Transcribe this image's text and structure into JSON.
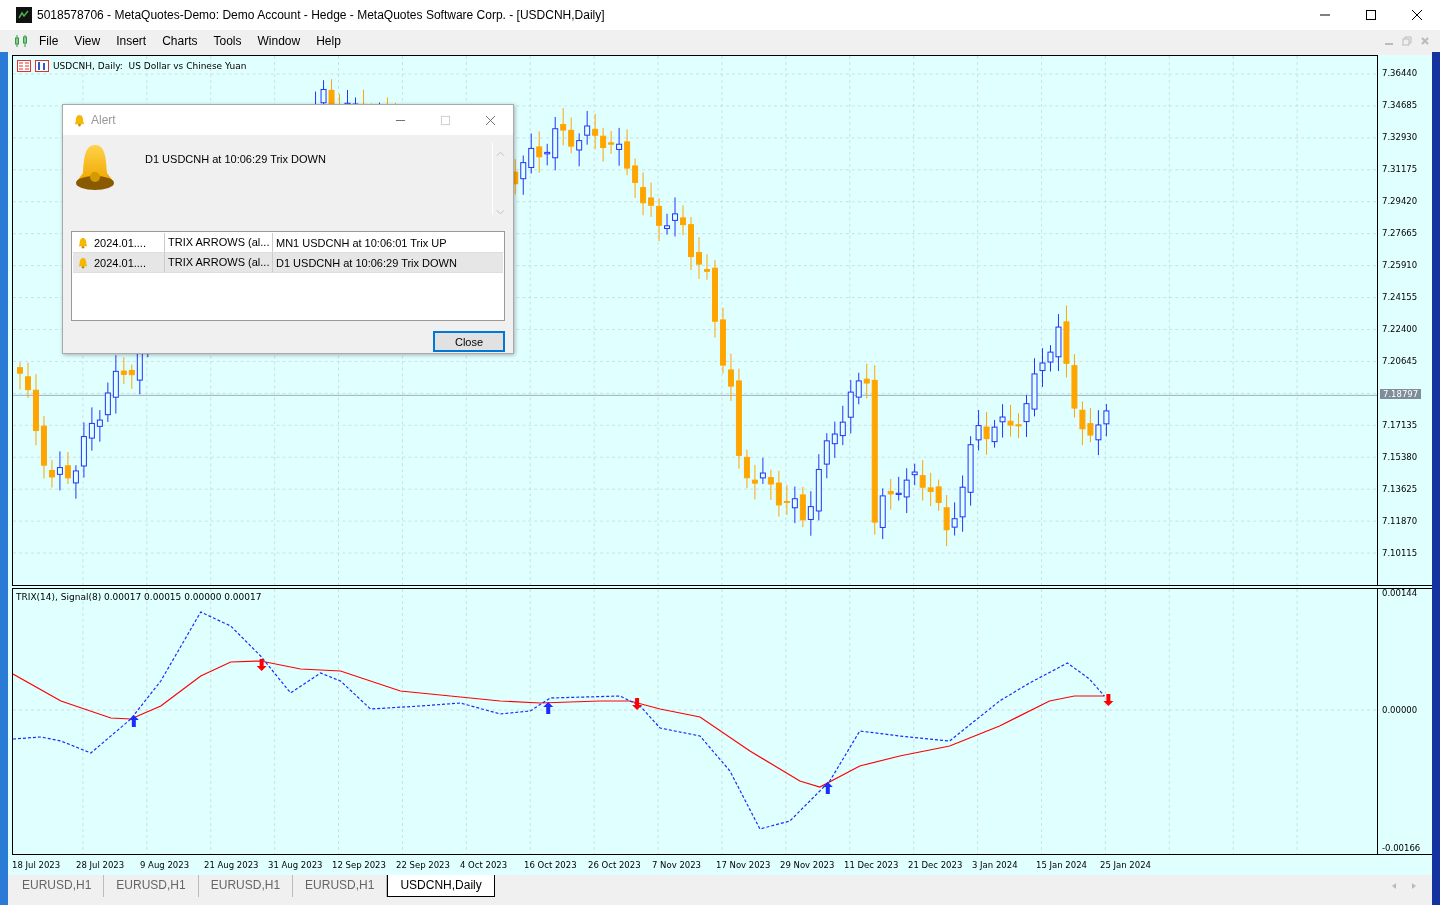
{
  "window": {
    "title": "5018578706 - MetaQuotes-Demo: Demo Account - Hedge - MetaQuotes Software Corp. - [USDCNH,Daily]"
  },
  "menu": [
    "File",
    "View",
    "Insert",
    "Charts",
    "Tools",
    "Window",
    "Help"
  ],
  "chart": {
    "header": "USDCNH, Daily:  US Dollar vs Chinese Yuan",
    "price_axis": [
      "7.36440",
      "7.34685",
      "7.32930",
      "7.31175",
      "7.29420",
      "7.27665",
      "7.25910",
      "7.24155",
      "7.22400",
      "7.20645",
      "7.17135",
      "7.15380",
      "7.13625",
      "7.11870",
      "7.10115"
    ],
    "current_price": "7.18797",
    "indicator_label": "TRIX(14), Signal(8) 0.00017 0.00015 0.00000 0.00017",
    "indicator_axis": [
      "0.00144",
      "0.00000",
      "-0.00166"
    ],
    "time_axis": [
      "18 Jul 2023",
      "28 Jul 2023",
      "9 Aug 2023",
      "21 Aug 2023",
      "31 Aug 2023",
      "12 Sep 2023",
      "22 Sep 2023",
      "4 Oct 2023",
      "16 Oct 2023",
      "26 Oct 2023",
      "7 Nov 2023",
      "17 Nov 2023",
      "29 Nov 2023",
      "11 Dec 2023",
      "21 Dec 2023",
      "3 Jan 2024",
      "15 Jan 2024",
      "25 Jan 2024"
    ]
  },
  "tabs": [
    {
      "label": "EURUSD,H1",
      "selected": false
    },
    {
      "label": "EURUSD,H1",
      "selected": false
    },
    {
      "label": "EURUSD,H1",
      "selected": false
    },
    {
      "label": "EURUSD,H1",
      "selected": false
    },
    {
      "label": "USDCNH,Daily",
      "selected": true
    }
  ],
  "alert": {
    "title": "Alert",
    "message": "D1 USDCNH at 10:06:29 Trix DOWN",
    "rows": [
      {
        "time": "2024.01....",
        "source": "TRIX ARROWS (al...",
        "message": "MN1 USDCNH at 10:06:01 Trix UP",
        "selected": false
      },
      {
        "time": "2024.01....",
        "source": "TRIX ARROWS (al...",
        "message": "D1 USDCNH at 10:06:29 Trix DOWN",
        "selected": true
      }
    ],
    "button": "Close"
  }
}
